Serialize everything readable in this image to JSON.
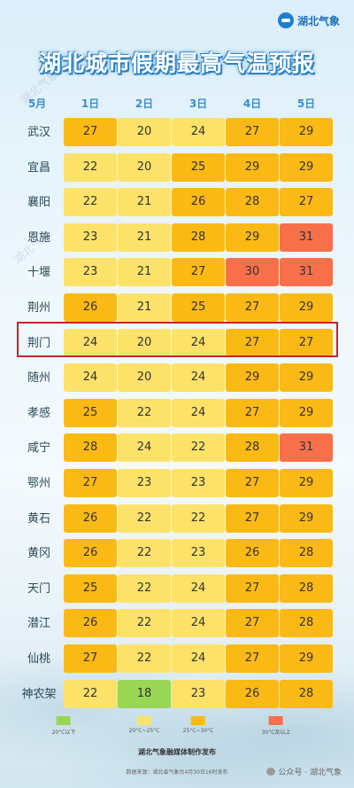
{
  "brand": {
    "name": "湖北气象",
    "logo_icon": "hubei-weather-logo-icon"
  },
  "title": "湖北城市假期最高气温预报",
  "watermarks": [
    "湖北气象",
    "湖北气象"
  ],
  "header": {
    "month": "5月",
    "days": [
      "1日",
      "2日",
      "3日",
      "4日",
      "5日"
    ]
  },
  "colors": {
    "green": "#98d654",
    "yellow": "#fde26a",
    "orange": "#fbb916",
    "red": "#f8704a",
    "highlight": "#c8232a"
  },
  "rows": [
    {
      "city": "武汉",
      "temps": [
        27,
        20,
        24,
        27,
        29
      ]
    },
    {
      "city": "宜昌",
      "temps": [
        22,
        20,
        25,
        29,
        29
      ]
    },
    {
      "city": "襄阳",
      "temps": [
        22,
        21,
        26,
        28,
        27
      ]
    },
    {
      "city": "恩施",
      "temps": [
        23,
        21,
        28,
        29,
        31
      ]
    },
    {
      "city": "十堰",
      "temps": [
        23,
        21,
        27,
        30,
        31
      ]
    },
    {
      "city": "荆州",
      "temps": [
        26,
        21,
        25,
        27,
        29
      ]
    },
    {
      "city": "荆门",
      "temps": [
        24,
        20,
        24,
        27,
        27
      ]
    },
    {
      "city": "随州",
      "temps": [
        24,
        20,
        24,
        29,
        29
      ]
    },
    {
      "city": "孝感",
      "temps": [
        25,
        22,
        24,
        27,
        29
      ]
    },
    {
      "city": "咸宁",
      "temps": [
        28,
        24,
        22,
        28,
        31
      ]
    },
    {
      "city": "鄂州",
      "temps": [
        27,
        23,
        23,
        27,
        29
      ]
    },
    {
      "city": "黄石",
      "temps": [
        26,
        22,
        22,
        27,
        29
      ]
    },
    {
      "city": "黄冈",
      "temps": [
        26,
        22,
        23,
        26,
        28
      ]
    },
    {
      "city": "天门",
      "temps": [
        25,
        22,
        24,
        27,
        28
      ]
    },
    {
      "city": "潜江",
      "temps": [
        26,
        22,
        24,
        27,
        28
      ]
    },
    {
      "city": "仙桃",
      "temps": [
        27,
        22,
        24,
        27,
        29
      ]
    },
    {
      "city": "神农架",
      "temps": [
        22,
        18,
        23,
        26,
        28
      ]
    }
  ],
  "highlighted_city": "荆门",
  "legend": [
    {
      "label": "20°C以下",
      "color": "#98d654"
    },
    {
      "label": "20°C~25°C",
      "color": "#fde26a"
    },
    {
      "label": "25°C~30°C",
      "color": "#fbb916"
    },
    {
      "label": "30°C及以上",
      "color": "#f8704a"
    }
  ],
  "footer": {
    "publisher": "湖北气象融媒体制作发布",
    "source": "数据来源：湖北省气象台4月30日16时发布",
    "wechat": "公众号 · 湖北气象"
  }
}
